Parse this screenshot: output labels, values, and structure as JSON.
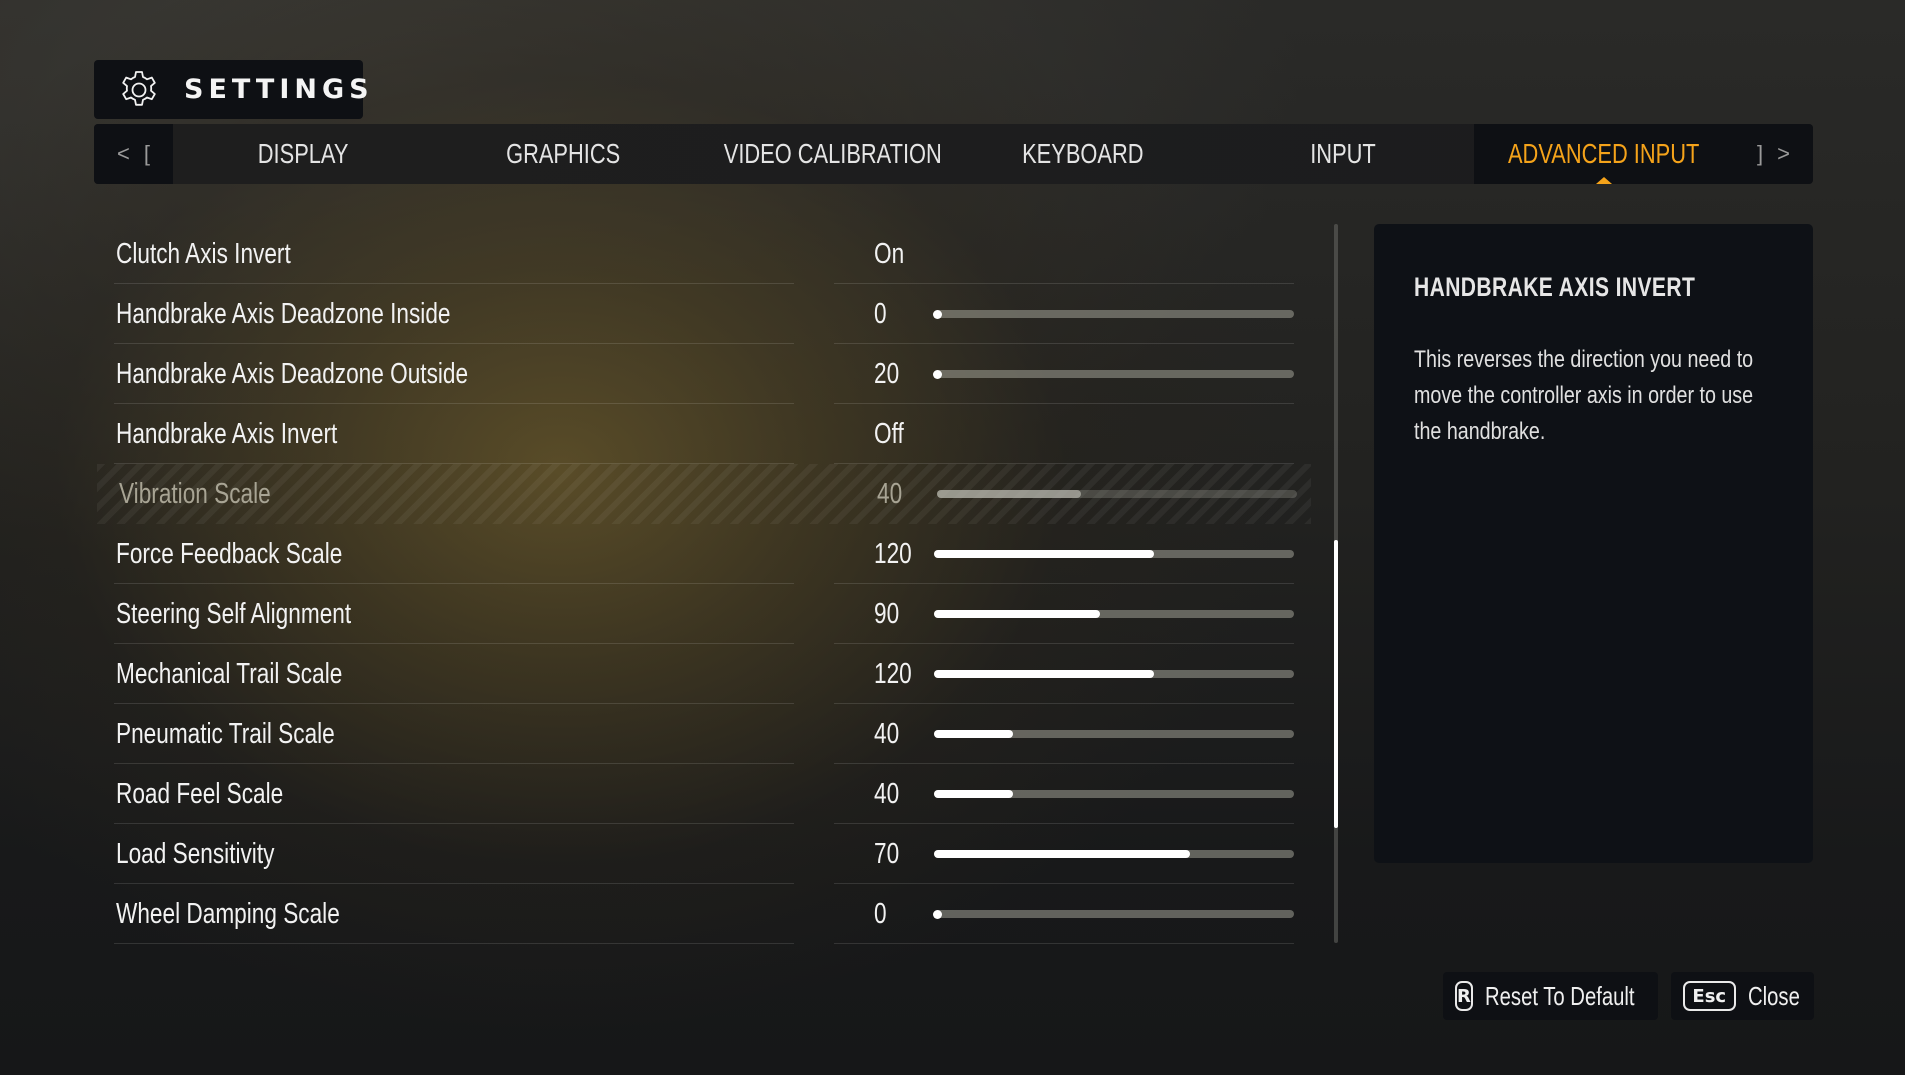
{
  "header": {
    "title": "SETTINGS",
    "icon": "gear-icon"
  },
  "tabs": {
    "prev_hint": "<",
    "prev_key": "[",
    "next_key": "]",
    "next_hint": ">",
    "items": [
      {
        "label": "DISPLAY",
        "active": false
      },
      {
        "label": "GRAPHICS",
        "active": false
      },
      {
        "label": "VIDEO CALIBRATION",
        "active": false
      },
      {
        "label": "KEYBOARD",
        "active": false
      },
      {
        "label": "INPUT",
        "active": false
      },
      {
        "label": "ADVANCED INPUT",
        "active": true
      }
    ],
    "active_color": "#f5a31a"
  },
  "settings": [
    {
      "label": "Clutch Axis Invert",
      "type": "toggle",
      "value": "On"
    },
    {
      "label": "Handbrake Axis Deadzone Inside",
      "type": "slider",
      "value": "0",
      "fill": 0.0
    },
    {
      "label": "Handbrake Axis Deadzone Outside",
      "type": "slider",
      "value": "20",
      "fill": 0.0
    },
    {
      "label": "Handbrake Axis Invert",
      "type": "toggle",
      "value": "Off"
    },
    {
      "label": "Vibration Scale",
      "type": "slider",
      "value": "40",
      "fill": 0.4,
      "disabled": true
    },
    {
      "label": "Force Feedback Scale",
      "type": "slider",
      "value": "120",
      "fill": 0.61
    },
    {
      "label": "Steering Self Alignment",
      "type": "slider",
      "value": "90",
      "fill": 0.46
    },
    {
      "label": "Mechanical Trail Scale",
      "type": "slider",
      "value": "120",
      "fill": 0.61
    },
    {
      "label": "Pneumatic Trail Scale",
      "type": "slider",
      "value": "40",
      "fill": 0.22
    },
    {
      "label": "Road Feel Scale",
      "type": "slider",
      "value": "40",
      "fill": 0.22
    },
    {
      "label": "Load Sensitivity",
      "type": "slider",
      "value": "70",
      "fill": 0.71
    },
    {
      "label": "Wheel Damping Scale",
      "type": "slider",
      "value": "0",
      "fill": 0.0
    }
  ],
  "scrollbar": {
    "thumb_start": 0.44,
    "thumb_end": 0.84
  },
  "info": {
    "title": "HANDBRAKE AXIS INVERT",
    "body": "This reverses the direction you need to move the controller axis in order to use the handbrake."
  },
  "footer": {
    "reset": {
      "key": "R",
      "label": "Reset To Default"
    },
    "close": {
      "key": "Esc",
      "label": "Close"
    }
  }
}
